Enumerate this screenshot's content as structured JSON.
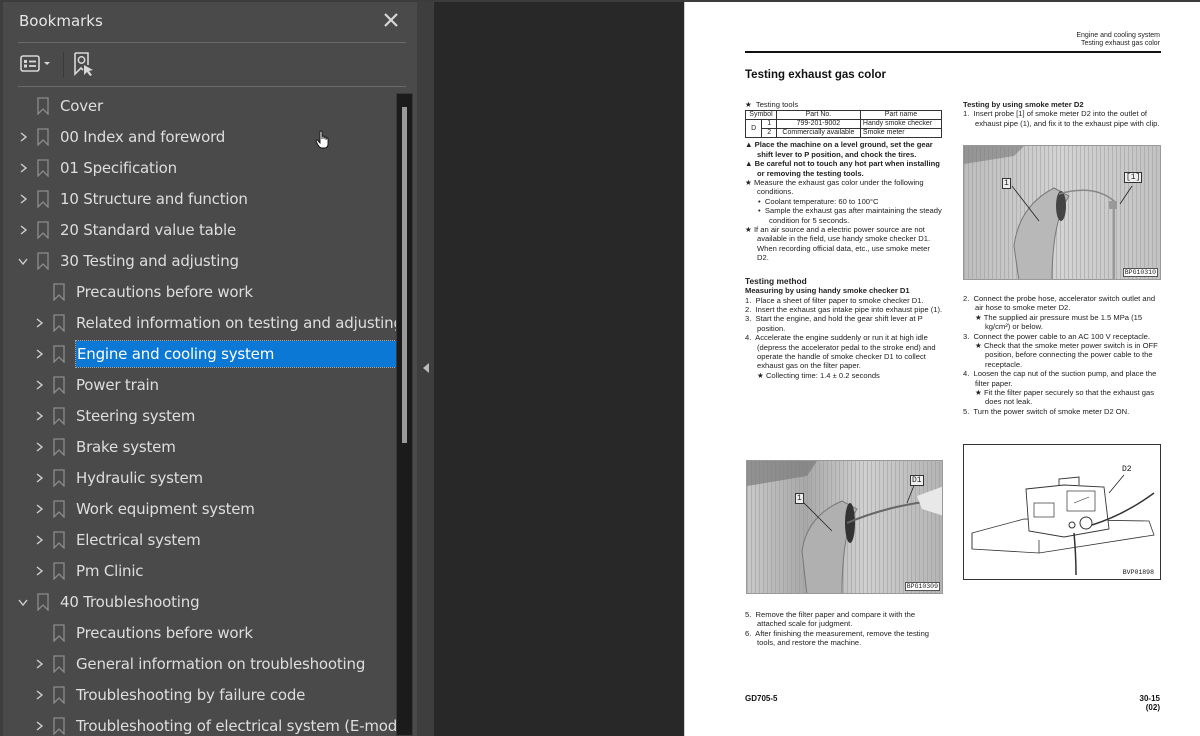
{
  "panel": {
    "title": "Bookmarks",
    "close_icon": "close-icon",
    "options_icon": "bookmark-options-icon",
    "find_icon": "find-current-bookmark-icon"
  },
  "colors": {
    "selection": "#0a78d4",
    "panel_bg": "#4a4a4a",
    "viewer_bg": "#282828"
  },
  "bookmarks": [
    {
      "label": "Cover",
      "level": 0,
      "expander": "none"
    },
    {
      "label": "00 Index and foreword",
      "level": 0,
      "expander": "collapsed"
    },
    {
      "label": "01 Specification",
      "level": 0,
      "expander": "collapsed"
    },
    {
      "label": "10 Structure and function",
      "level": 0,
      "expander": "collapsed"
    },
    {
      "label": "20 Standard value table",
      "level": 0,
      "expander": "collapsed"
    },
    {
      "label": "30 Testing and adjusting",
      "level": 0,
      "expander": "expanded"
    },
    {
      "label": "Precautions before work",
      "level": 1,
      "expander": "none"
    },
    {
      "label": "Related information on testing and adjusting",
      "level": 1,
      "expander": "collapsed"
    },
    {
      "label": "Engine and cooling system",
      "level": 1,
      "expander": "collapsed",
      "selected": true
    },
    {
      "label": "Power train",
      "level": 1,
      "expander": "collapsed"
    },
    {
      "label": "Steering system",
      "level": 1,
      "expander": "collapsed"
    },
    {
      "label": "Brake system",
      "level": 1,
      "expander": "collapsed"
    },
    {
      "label": "Hydraulic system",
      "level": 1,
      "expander": "collapsed"
    },
    {
      "label": "Work equipment system",
      "level": 1,
      "expander": "collapsed"
    },
    {
      "label": "Electrical system",
      "level": 1,
      "expander": "collapsed"
    },
    {
      "label": "Pm Clinic",
      "level": 1,
      "expander": "collapsed"
    },
    {
      "label": "40 Troubleshooting",
      "level": 0,
      "expander": "expanded"
    },
    {
      "label": "Precautions before work",
      "level": 1,
      "expander": "none"
    },
    {
      "label": "General information on troubleshooting",
      "level": 1,
      "expander": "collapsed"
    },
    {
      "label": "Troubleshooting by failure code",
      "level": 1,
      "expander": "collapsed"
    },
    {
      "label": "Troubleshooting of electrical system (E-mode)",
      "level": 1,
      "expander": "collapsed"
    }
  ],
  "document": {
    "header_line1": "Engine and cooling system",
    "header_line2": "Testing exhaust gas color",
    "title": "Testing exhaust gas color",
    "left": {
      "tools_heading": "Testing tools",
      "table": {
        "headers": [
          "Symbol",
          "Part No.",
          "Part name"
        ],
        "symbol": "D",
        "rows": [
          {
            "num": "1",
            "part_no": "799-201-9002",
            "part_name": "Handy smoke checker"
          },
          {
            "num": "2",
            "part_no": "Commercially available",
            "part_name": "Smoke meter"
          }
        ]
      },
      "warn1": "Place the machine on a level ground, set the gear shift lever to P position, and chock the tires.",
      "warn2": "Be careful not to touch any hot part when installing or removing the testing tools.",
      "note1": "Measure the exhaust gas color under the following conditions.",
      "bullet1": "Coolant temperature: 60 to 100°C",
      "bullet2": "Sample the exhaust gas after maintaining the steady condition for 5 seconds.",
      "note2": "If an air source and a electric power source are not available in the field, use handy smoke checker D1. When recording official data, etc., use smoke meter D2.",
      "method_heading": "Testing method",
      "method_sub": "Measuring by using handy smoke checker D1",
      "steps": [
        "1.  Place a sheet of filter paper to smoke checker D1.",
        "2.  Insert the exhaust gas intake pipe into exhaust pipe (1).",
        "3.  Start the engine, and hold the gear shift lever at P position.",
        "4.  Accelerate the engine suddenly or run it at high idle (depress the accelerator pedal to the stroke end) and operate the handle of smoke checker D1 to collect exhaust gas on the filter paper."
      ],
      "step4_note": "Collecting time: 1.4 ± 0.2 seconds",
      "photo1_code": "BPG10309",
      "photo1_callout_a": "1",
      "photo1_callout_b": "D1",
      "steps_after": [
        "5.  Remove the filter paper and compare it with the attached scale for judgment.",
        "6.  After finishing the measurement, remove the testing tools, and restore the machine."
      ]
    },
    "right": {
      "heading": "Testing by using smoke meter D2",
      "step1": "1.  Insert probe [1] of smoke meter D2 into the outlet of exhaust pipe (1), and fix it to the exhaust pipe with clip.",
      "photo2_code": "BPG10310",
      "photo2_callout_a": "1",
      "photo2_callout_b": "[1]",
      "step2": "2.  Connect the probe hose, accelerator switch outlet and air hose to smoke meter D2.",
      "step2_note": "The supplied air pressure must be 1.5 MPa (15 kg/cm²) or below.",
      "step3": "3.  Connect the power cable to an AC 100 V receptacle.",
      "step3_note": "Check that the smoke meter power switch is in OFF position, before connecting the power cable to the receptacle.",
      "step4": "4.  Loosen the cap nut of the suction pump, and place the filter paper.",
      "step4_note": "Fit the filter paper securely so that the exhaust gas does not leak.",
      "step5": "5.  Turn the power switch of smoke meter D2 ON.",
      "figure_code": "BVP01898",
      "figure_callout": "D2"
    },
    "footer_model": "GD705-5",
    "footer_page": "30-15",
    "footer_rev": "(02)"
  }
}
